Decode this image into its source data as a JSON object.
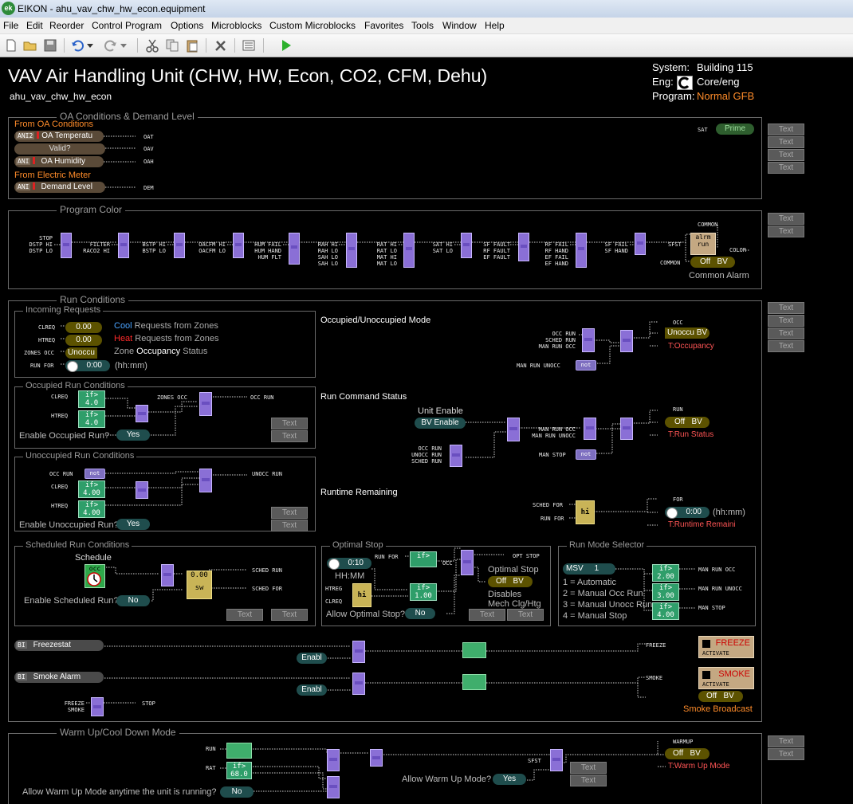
{
  "window": {
    "title": "EIKON - ahu_vav_chw_hw_econ.equipment",
    "app_icon": "ek"
  },
  "menu": [
    "File",
    "Edit",
    "Reorder",
    "Control Program",
    "Options",
    "Microblocks",
    "Custom Microblocks",
    "Favorites",
    "Tools",
    "Window",
    "Help"
  ],
  "header": {
    "title": "VAV Air Handling Unit (CHW, HW, Econ, CO2, CFM, Dehu)",
    "subtitle": "ahu_vav_chw_hw_econ",
    "system_label": "System:",
    "system_value": "Building 115",
    "eng_label": "Eng:",
    "eng_value": "Core/eng",
    "program_label": "Program:",
    "program_value": "Normal GFB"
  },
  "text_btn": "Text",
  "oa": {
    "title": "OA Conditions & Demand Level",
    "from_oa": "From OA Conditions",
    "from_meter": "From Electric Meter",
    "ani2": "ANI2",
    "ani": "ANI",
    "oa_temp": "OA Temperatu",
    "valid": "Valid?",
    "oa_hum": "OA Humidity",
    "demand": "Demand Level",
    "out_oat": "OAT",
    "out_oav": "OAV",
    "out_oah": "OAH",
    "out_dem": "DEM",
    "sat": "SAT",
    "prime": "Prime"
  },
  "pc": {
    "title": "Program Color",
    "inputs": [
      "STOP\nDSTP HI\nDSTP LO",
      "FILTER\nRACO2 HI",
      "BSTP HI\nBSTP LO",
      "OACFM HI\nOACFM LO",
      "HUM FAIL\nHUM HAND\nHUM FLT",
      "RAH HI\nRAH LO\nSAH LO\nSAH LO",
      "RAT HI\nRAT LO\nMAT HI\nMAT LO",
      "SAT HI\nSAT LO",
      "SF FAULT\nRF FAULT\nEF FAULT",
      "RF FAIL\nRF HAND\nEF FAIL\nEF HAND",
      "SF FAIL\nSF HAND"
    ],
    "sfst": "SFST",
    "common": "COMMON",
    "color": "COLOR",
    "alrm": "alrm",
    "run": "run",
    "common_in": "COMMON",
    "off": "Off",
    "bv": "BV",
    "common_alarm": "Common Alarm"
  },
  "rc": {
    "title": "Run Conditions",
    "incoming": "Incoming Requests",
    "clreq": "CLREQ",
    "htreq": "HTREQ",
    "zones_occ": "ZONES OCC",
    "run_for": "RUN FOR",
    "clreq_val": "0.00",
    "htreq_val": "0.00",
    "zones_val": "Unoccu",
    "runfor_val": "0:00",
    "cool": "Cool",
    "heat": "Heat",
    "req_zones": " Requests from Zones",
    "zone_occ": "Zone ",
    "occupancy": "Occupancy",
    "status": " Status",
    "hhmm": "(hh:mm)",
    "occ_run_cond": "Occupied Run Conditions",
    "if1": "if>",
    "v40": "4.0",
    "enable_occ": "Enable Occupied Run?",
    "yes": "Yes",
    "occ_run": "OCC RUN",
    "unocc_run_cond": "Unoccupied Run Conditions",
    "not": "not",
    "v400": "4.00",
    "enable_unocc": "Enable Unoccupied Run?",
    "unocc_run": "UNOCC RUN",
    "sched_run_cond": "Scheduled Run Conditions",
    "schedule": "Schedule",
    "occ": "occ",
    "sw_val": "0.00",
    "sw": "sw",
    "enable_sched": "Enable Scheduled Run?",
    "no": "No",
    "sched_run": "SCHED RUN",
    "sched_for": "SCHED FOR",
    "ou_mode": "Occupied/Unoccupied Mode",
    "occ_run_in": "OCC RUN\nSCHED RUN\nMAN RUN OCC",
    "man_run_unocc": "MAN RUN UNOCC",
    "occ_out": "OCC",
    "unoccu": "Unoccu",
    "t_occ": "T:Occupancy",
    "rcs": "Run Command Status",
    "unit_enable": "Unit Enable",
    "bv_enable": "BV Enable",
    "rcs_in1": "MAN RUN OCC\nMAN RUN UNOCC",
    "rcs_in2": "OCC RUN\nUNOCC RUN\nSCHED RUN",
    "man_stop": "MAN STOP",
    "run_out": "RUN",
    "t_run": "T:Run Status",
    "rr": "Runtime Remaining",
    "sched_for_in": "SCHED FOR",
    "run_for_in": "RUN FOR",
    "hi": "hi",
    "for_out": "FOR",
    "rr_val": "0:00",
    "t_rr": "T:Runtime Remaini",
    "opt_stop": "Optimal Stop",
    "os_time": "0:10",
    "os_hhmm": "HH:MM",
    "htreg": "HTREG",
    "clreq2": "CLREQ",
    "os_runfor": "RUN FOR",
    "os_occ": "OCC",
    "os_v": "1.00",
    "opt_stop_out": "OPT STOP",
    "os_lbl": "Optimal Stop",
    "disables": "Disables",
    "mech": "Mech Clg/Htg",
    "allow_os": "Allow Optimal Stop?",
    "rms": "Run Mode Selector",
    "msv": "MSV",
    "msv_val": "1",
    "rm1": "1 = Automatic",
    "rm2": "2 = Manual Occ Run",
    "rm3": "3 = Manual Unocc Run",
    "rm4": "4 = Manual Stop",
    "v200": "2.00",
    "v300": "3.00",
    "v400b": "4.00",
    "man_run_occ": "MAN RUN OCC",
    "man_run_unocc_out": "MAN RUN UNOCC",
    "man_stop_out": "MAN STOP",
    "bi": "BI",
    "freezestat": "Freezestat",
    "enabl": "Enabl",
    "freeze_out": "FREEZE",
    "freeze": "FREEZE",
    "activate": "ACTIVATE",
    "smoke_alarm": "Smoke Alarm",
    "smoke_out": "SMOKE",
    "smoke": "SMOKE",
    "smoke_broadcast": "Smoke Broadcast",
    "fz_in": "FREEZE\nSMOKE",
    "stop_out": "STOP"
  },
  "wu": {
    "title": "Warm Up/Cool Down Mode",
    "run": "RUN",
    "rat": "RAT",
    "v680": "68.0",
    "sfst": "SFST",
    "allow": "Allow Warm Up Mode?",
    "yes": "Yes",
    "anytime": "Allow Warm Up Mode anytime the unit is running?",
    "no": "No",
    "warmup_out": "WARMUP",
    "off": "Off",
    "bv": "BV",
    "t_wu": "T:Warm Up Mode"
  }
}
